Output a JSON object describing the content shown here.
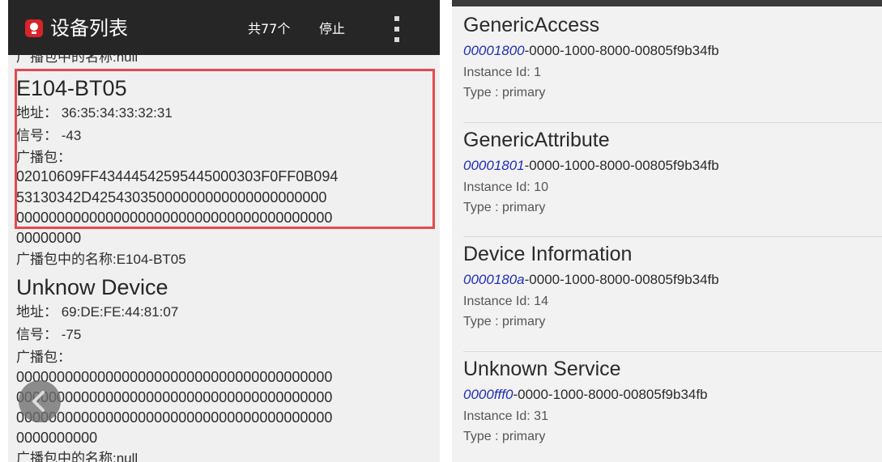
{
  "toolbar": {
    "title": "设备列表",
    "count": "共77个",
    "stop_label": "停止"
  },
  "devices_left": {
    "prev_name_line": "广播包中的名称:null",
    "device1": {
      "name": "E104-BT05",
      "address": "地址： 36:35:34:33:32:31",
      "signal": "信号： -43",
      "adv_label": "广播包：",
      "adv_lines": [
        "02010609FF43444542595445000303F0FF0B094",
        "53130342D42543035000000000000000000000",
        "000000000000000000000000000000000000000",
        "00000000"
      ],
      "name_in_adv": "广播包中的名称:E104-BT05"
    },
    "device2": {
      "name": "Unknow Device",
      "address": "地址： 69:DE:FE:44:81:07",
      "signal": "信号： -75",
      "adv_label": "广播包：",
      "adv_lines": [
        "000000000000000000000000000000000000000",
        "000000000000000000000000000000000000000",
        "000000000000000000000000000000000000000",
        "0000000000"
      ],
      "name_in_adv": "广播包中的名称:null"
    }
  },
  "services": [
    {
      "name": "GenericAccess",
      "uuid_short": "00001800",
      "uuid_rest": "-0000-1000-8000-00805f9b34fb",
      "instance": "Instance Id: 1",
      "type": "Type : primary"
    },
    {
      "name": "GenericAttribute",
      "uuid_short": "00001801",
      "uuid_rest": "-0000-1000-8000-00805f9b34fb",
      "instance": "Instance Id: 10",
      "type": "Type : primary"
    },
    {
      "name": "Device Information",
      "uuid_short": "0000180a",
      "uuid_rest": "-0000-1000-8000-00805f9b34fb",
      "instance": "Instance Id: 14",
      "type": "Type : primary"
    },
    {
      "name": "Unknown Service",
      "uuid_short": "0000fff0",
      "uuid_rest": "-0000-1000-8000-00805f9b34fb",
      "instance": "Instance Id: 31",
      "type": "Type : primary"
    }
  ],
  "colors": {
    "toolbar_bg": "#262626",
    "highlight_border": "#e34a4f",
    "uuid_accent": "#1f2fb3",
    "panel_bg": "#f0f0f0"
  },
  "icons": {
    "app": "app-logo-icon",
    "overflow": "overflow-menu-icon",
    "back": "chevron-left-icon"
  }
}
